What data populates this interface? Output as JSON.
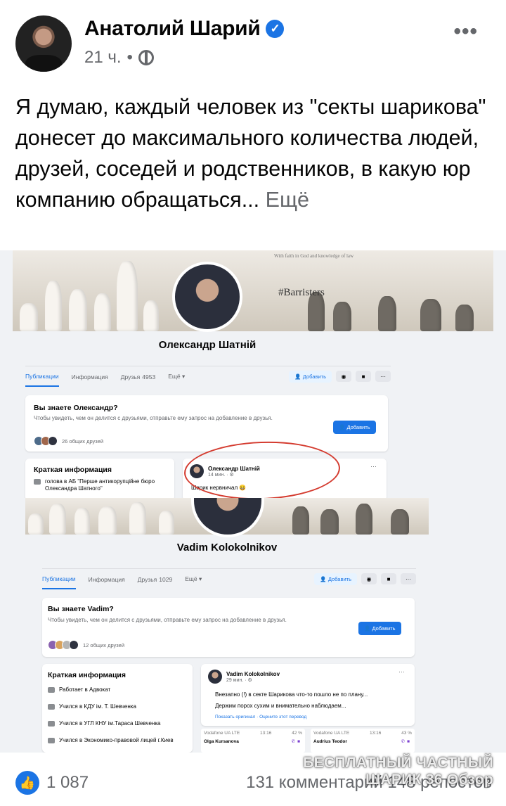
{
  "post": {
    "author": "Анатолий Шарий",
    "verified_icon": "check",
    "time": "21 ч.",
    "separator": "•",
    "privacy_icon": "globe-icon",
    "more_label": "•••",
    "text": "Я думаю, каждый человек из \"секты шарикова\" донесет до максимального количества людей, друзей, соседей и родственников, в какую юр компанию обращаться...",
    "see_more": "Ещё"
  },
  "screenshot1": {
    "cover_motto": "With faith in God and knowledge of law",
    "cover_tag": "#Barristers",
    "name": "Олександр Шатній",
    "tabs": [
      {
        "label": "Публикации"
      },
      {
        "label": "Информация"
      },
      {
        "label": "Друзья",
        "count": "4953"
      },
      {
        "label": "Ещё ▾"
      }
    ],
    "add_label": "Добавить",
    "know_title": "Вы знаете Олександр?",
    "know_sub": "Чтобы увидеть, чем он делится с друзьями, отправьте ему запрос на добавление в друзья.",
    "add_button": "Добавить",
    "mutual": "26 общих друзей",
    "info_title": "Краткая информация",
    "info_item": "голова в АБ \"Перше антикорупційне бюро Олександра Шатного\"",
    "mini_post": {
      "name": "Олександр Шатній",
      "time": "14 мин. · ⚙",
      "text": "Шарик нервничал 😆"
    }
  },
  "screenshot2": {
    "name": "Vadim Kolokolnikov",
    "tabs": [
      {
        "label": "Публикации"
      },
      {
        "label": "Информация"
      },
      {
        "label": "Друзья",
        "count": "1029"
      },
      {
        "label": "Ещё ▾"
      }
    ],
    "add_label": "Добавить",
    "know_title": "Вы знаете Vadim?",
    "know_sub": "Чтобы увидеть, чем он делится с друзьями, отправьте ему запрос на добавление в друзья.",
    "add_button": "Добавить",
    "mutual": "12 общих друзей",
    "info_title": "Краткая информация",
    "info_items": [
      "Работает в Адвокат",
      "Учился в КДУ ім. Т. Шевченка",
      "Учился в УГЛ КНУ ім.Тараса Шевченка",
      "Учился в Экономико-правовой лицей г.Киев"
    ],
    "mini_post": {
      "name": "Vadim Kolokolnikov",
      "time": "29 мин. · ⚙",
      "line1": "Внезапно (!) в секте Шарикова что-то пошло не по плану...",
      "line2": "Держим порох сухим и внимательно наблюдаем...",
      "links": "Показать оригинал · Оцените этот перевод"
    },
    "calls": [
      {
        "carrier": "Vodafone UA LTE",
        "time": "13:16",
        "battery": "42 %",
        "name": "Olga Kursanova"
      },
      {
        "carrier": "Vodafone UA LTE",
        "time": "13:16",
        "battery": "43 %",
        "name": "Audrius Teodor"
      }
    ]
  },
  "footer": {
    "likes": "1 087",
    "comments": "131 комментарий 148 репостов",
    "watermark_line1": "БЕСПЛАТНЫЙ ЧАСТНЫЙ",
    "watermark_line2": "ШАРИК 36 Обзор"
  }
}
